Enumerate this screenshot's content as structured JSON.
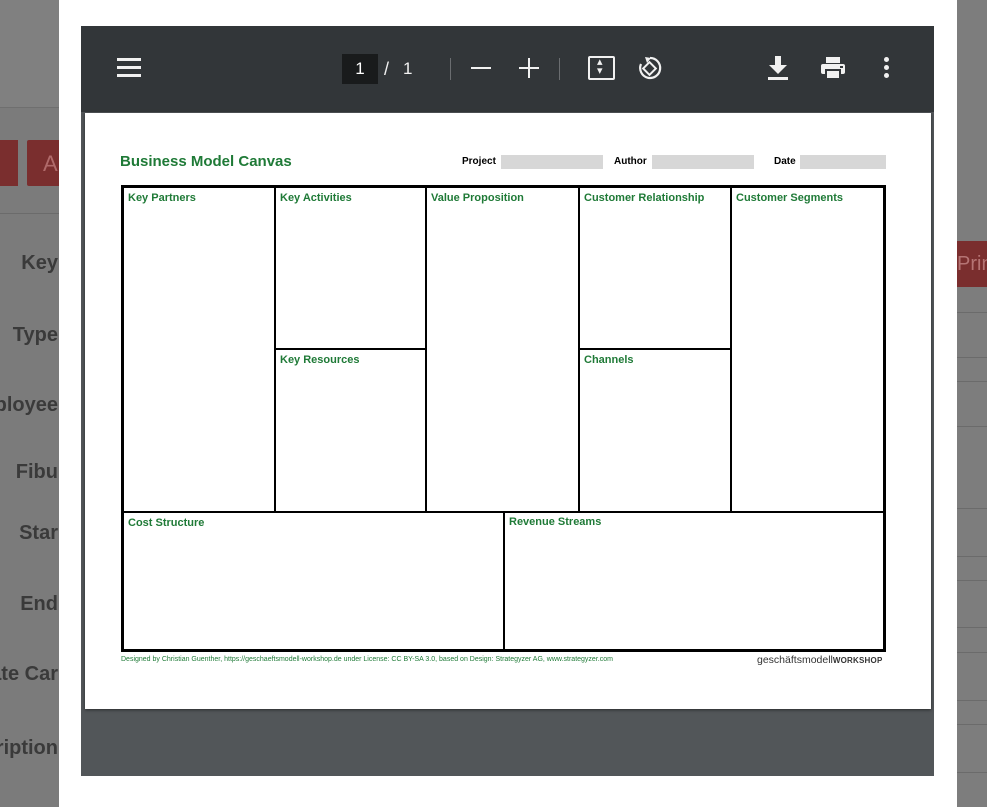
{
  "background": {
    "button_partial": "A",
    "print_partial": "Print",
    "labels": [
      "Key",
      "Type",
      "ployee",
      "Fibu",
      "Star",
      "End",
      "ate Car",
      "cription"
    ]
  },
  "viewer": {
    "toolbar": {
      "current_page": "1",
      "page_separator": "/",
      "total_pages": "1"
    },
    "icons": [
      "menu-icon",
      "zoom-out-icon",
      "zoom-in-icon",
      "fit-page-icon",
      "rotate-icon",
      "download-icon",
      "print-icon",
      "more-icon"
    ]
  },
  "document": {
    "title": "Business Model Canvas",
    "fields": {
      "project_label": "Project",
      "author_label": "Author",
      "date_label": "Date"
    },
    "blocks": {
      "key_partners": "Key Partners",
      "key_activities": "Key Activities",
      "key_resources": "Key Resources",
      "value_proposition": "Value Proposition",
      "customer_relationship": "Customer Relationship",
      "channels": "Channels",
      "customer_segments": "Customer Segments",
      "cost_structure": "Cost Structure",
      "revenue_streams": "Revenue Streams"
    },
    "footer_credit": "Designed by Christian Guenther, https://geschaeftsmodell-workshop.de under License: CC BY-SA 3.0, based on Design: Strategyzer AG, www.strategyzer.com",
    "footer_logo_light": "geschäftsmodell",
    "footer_logo_bold": "WORKSHOP"
  },
  "colors": {
    "accent_green": "#1f7a37",
    "toolbar": "#323639",
    "viewer_bg": "#525659"
  }
}
